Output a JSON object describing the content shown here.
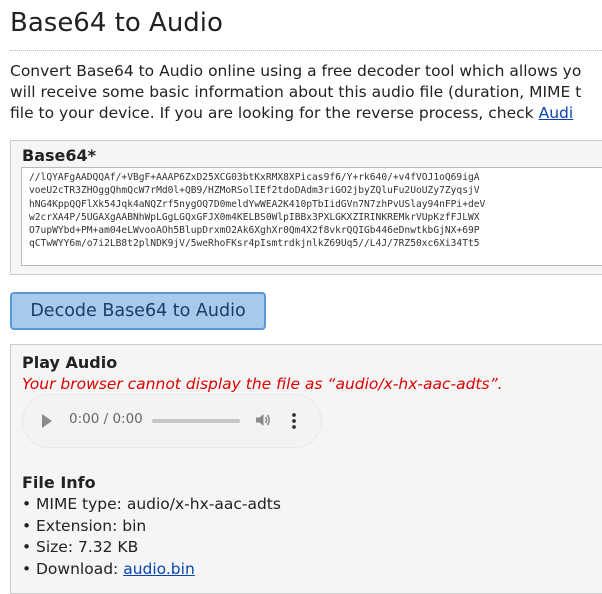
{
  "page": {
    "title": "Base64 to Audio"
  },
  "intro": {
    "line1": "Convert Base64 to Audio online using a free decoder tool which allows yo",
    "line2": "will receive some basic information about this audio file (duration, MIME t",
    "line3_text": "file to your device. If you are looking for the reverse process, check ",
    "line3_link": "Audi"
  },
  "input": {
    "label": "Base64*",
    "lines": [
      "//lQYAFgAADQQAf/+VBgF+AAAP6ZxD25XCG03btKxRMX8XPicas9f6/Y+rk640/+v4fVOJ1oQ69igA",
      "voeU2cTR3ZHOggQhmQcW7rMd0l+QB9/HZMoRSolIEf2tdoDAdm3riGO2jbyZQluFu2UoUZy7ZyqsjV",
      "hNG4KppQQFlXk54Jqk4aNQZrf5nygOQ7D0meldYwWEA2K410pTbIidGVn7N7zhPvUSlay94nFPi+deV",
      "w2crXA4P/5UGAXgAABNhWpLGgLGQxGFJX0m4KELBS0WlpIBBx3PXLGKXZIRINKREMkrVUpKzfFJLWX",
      "O7upWYbd+PM+am04eLWvooAOh5BlupDrxmO2Ak6XghXr0Qm4X2f8vkrQQIGb446eDnwtkbGjNX+69P",
      "qCTwWYY6m/o7i2LB8t2plNDK9jV/5weRhoFKsr4pIsmtrdkjnlkZ69Uq5//L4J/7RZ50xc6Xi34Tt5"
    ]
  },
  "decode_button": {
    "label": "Decode Base64 to Audio"
  },
  "output": {
    "play_heading": "Play Audio",
    "error_message": "Your browser cannot display the file as “audio/x-hx-aac-adts”.",
    "player": {
      "time": "0:00 / 0:00",
      "icons": [
        "play-icon",
        "volume-icon",
        "more-options-icon"
      ]
    },
    "info_heading": "File Info",
    "info": {
      "mime_label": "MIME type: ",
      "mime_value": "audio/x-hx-aac-adts",
      "extension_label": "Extension: ",
      "extension_value": "bin",
      "size_label": "Size: ",
      "size_value": "7.32 KB",
      "download_label": "Download: ",
      "download_link": "audio.bin"
    },
    "bullet": "•"
  },
  "colors": {
    "link": "#0645ad",
    "error": "#dd0000",
    "button_bg": "#a7c9ec",
    "button_border": "#5a9ad8",
    "panel_bg": "#f5f5f5"
  }
}
